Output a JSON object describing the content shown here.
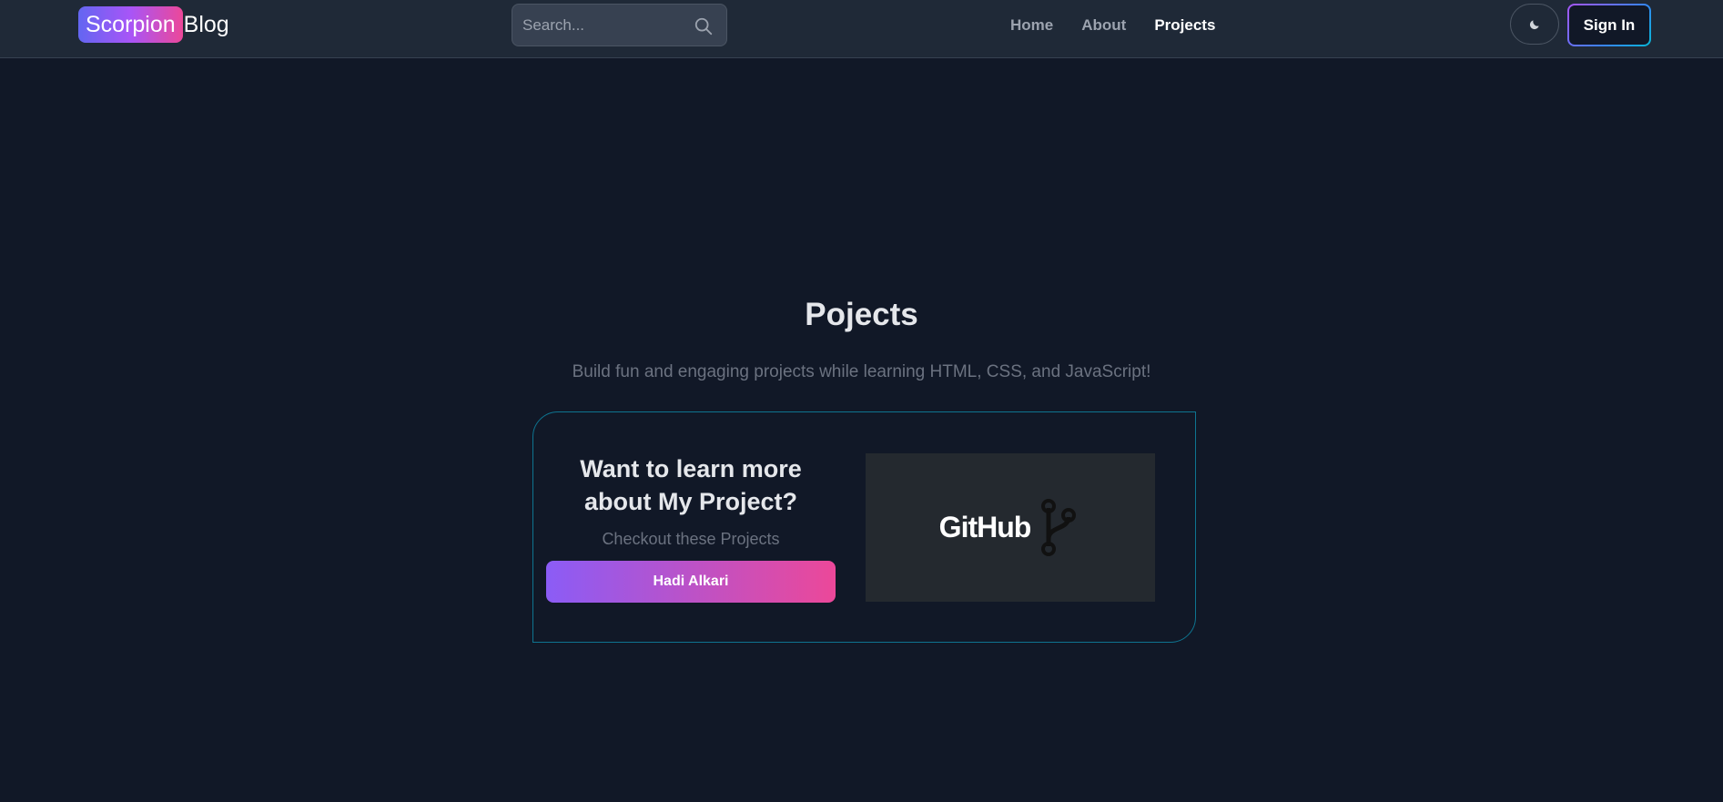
{
  "header": {
    "brand_badge": "Scorpion",
    "brand_rest": "Blog",
    "search_placeholder": "Search...",
    "search_icon": "search-icon",
    "nav": [
      {
        "label": "Home",
        "active": false
      },
      {
        "label": "About",
        "active": false
      },
      {
        "label": "Projects",
        "active": true
      }
    ],
    "theme_icon": "moon-icon",
    "signin_label": "Sign In"
  },
  "main": {
    "title": "Pojects",
    "subtitle": "Build fun and engaging projects while learning HTML, CSS, and JavaScript!",
    "card": {
      "heading": "Want to learn more about My Project?",
      "sub": "Checkout these Projects",
      "button_label": "Hadi Alkari",
      "image_word": "GitHub",
      "image_icon": "git-branch-icon"
    }
  },
  "colors": {
    "background": "#111827",
    "navbar": "#1f2937",
    "card_border": "#0e7490",
    "gradient_start": "#8b5cf6",
    "gradient_end": "#ec4899"
  }
}
